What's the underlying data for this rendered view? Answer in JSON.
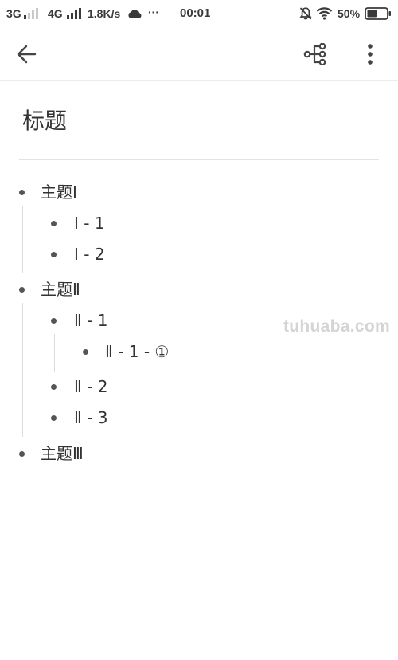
{
  "status_bar": {
    "network_1": "3G",
    "network_2": "4G",
    "speed": "1.8K/s",
    "more": "···",
    "time": "00:01",
    "battery_percent": "50%",
    "battery_level": 0.5,
    "icons": [
      "cloud-icon",
      "silent-bell-icon",
      "wifi-icon",
      "battery-icon"
    ]
  },
  "app_bar": {
    "icons": [
      "back-arrow-icon",
      "mind-map-icon",
      "more-vert-icon"
    ]
  },
  "document": {
    "title": "标题",
    "outline": [
      {
        "text": "主题Ⅰ",
        "level": 0
      },
      {
        "text": "Ⅰ - 1",
        "level": 1
      },
      {
        "text": "Ⅰ - 2",
        "level": 1
      },
      {
        "text": "主题Ⅱ",
        "level": 0
      },
      {
        "text": "Ⅱ - 1",
        "level": 1
      },
      {
        "text": "Ⅱ - 1 - ①",
        "level": 2
      },
      {
        "text": "Ⅱ - 2",
        "level": 1
      },
      {
        "text": "Ⅱ - 3",
        "level": 1
      },
      {
        "text": "主题Ⅲ",
        "level": 0
      }
    ]
  },
  "watermark": "tuhuaba.com"
}
